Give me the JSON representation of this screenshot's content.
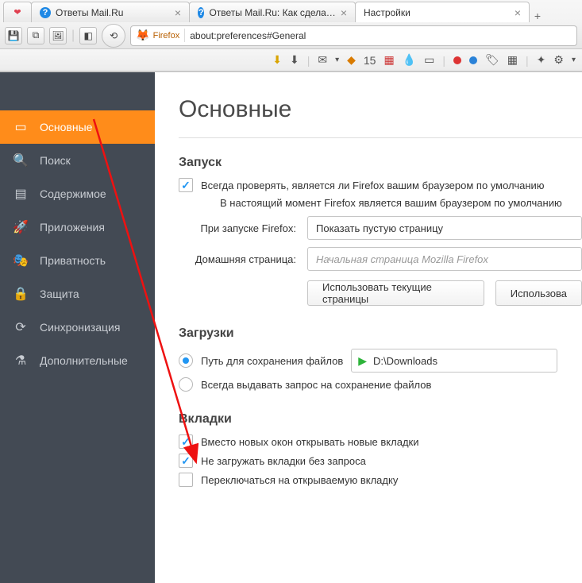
{
  "tabs": [
    {
      "label": "",
      "favicon": "❤"
    },
    {
      "label": "Ответы Mail.Ru",
      "favicon": "?"
    },
    {
      "label": "Ответы Mail.Ru: Как сдела…",
      "favicon": "?"
    },
    {
      "label": "Настройки",
      "favicon": "",
      "active": true
    }
  ],
  "addressbar": {
    "identity": "Firefox",
    "url": "about:preferences#General"
  },
  "iconbar_badge": "15",
  "sidebar": {
    "items": [
      {
        "icon": "▭",
        "label": "Основные",
        "active": true
      },
      {
        "icon": "🔍",
        "label": "Поиск"
      },
      {
        "icon": "▤",
        "label": "Содержимое"
      },
      {
        "icon": "🚀",
        "label": "Приложения"
      },
      {
        "icon": "🎭",
        "label": "Приватность"
      },
      {
        "icon": "🔒",
        "label": "Защита"
      },
      {
        "icon": "⟳",
        "label": "Синхронизация"
      },
      {
        "icon": "⚗",
        "label": "Дополнительные"
      }
    ]
  },
  "page": {
    "title": "Основные",
    "startup": {
      "heading": "Запуск",
      "check_default_label": "Всегда проверять, является ли Firefox вашим браузером по умолчанию",
      "check_default_checked": true,
      "current_default_text": "В настоящий момент Firefox является вашим браузером по умолчанию",
      "on_start_label": "При запуске Firefox:",
      "on_start_value": "Показать пустую страницу",
      "homepage_label": "Домашняя страница:",
      "homepage_placeholder": "Начальная страница Mozilla Firefox",
      "btn_use_current": "Использовать текущие страницы",
      "btn_use_bookmark": "Использова"
    },
    "downloads": {
      "heading": "Загрузки",
      "save_to_label": "Путь для сохранения файлов",
      "save_to_selected": true,
      "path_value": "D:\\Downloads",
      "ask_label": "Всегда выдавать запрос на сохранение файлов",
      "ask_selected": false
    },
    "tabs_section": {
      "heading": "Вкладки",
      "opt1_label": "Вместо новых окон открывать новые вкладки",
      "opt1_checked": true,
      "opt2_label": "Не загружать вкладки без запроса",
      "opt2_checked": true,
      "opt3_label": "Переключаться на открываемую вкладку",
      "opt3_checked": false
    }
  }
}
